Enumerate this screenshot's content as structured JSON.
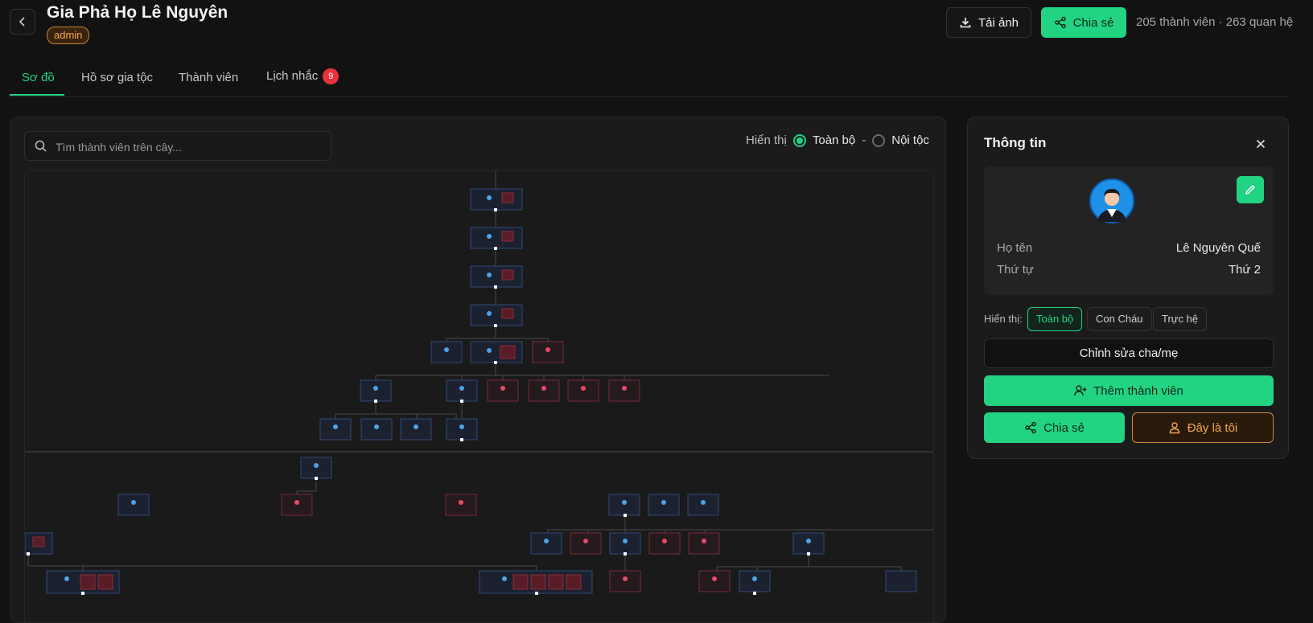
{
  "header": {
    "title": "Gia Phả Họ Lê Nguyên",
    "role_badge": "admin",
    "download_label": "Tải ảnh",
    "share_label": "Chia sẻ",
    "stats": "205 thành viên · 263 quan hệ"
  },
  "tabs": [
    {
      "label": "Sơ đồ",
      "active": true
    },
    {
      "label": "Hồ sơ gia tộc",
      "active": false
    },
    {
      "label": "Thành viên",
      "active": false
    },
    {
      "label": "Lịch nhắc",
      "active": false,
      "badge": "9"
    }
  ],
  "tree": {
    "search_placeholder": "Tìm thành viên trên cây...",
    "view_label": "Hiển thị",
    "view_options": [
      "Toàn bộ",
      "Nội tộc"
    ],
    "view_selected": "Toàn bộ",
    "separator": "-"
  },
  "info_panel": {
    "title": "Thông tin",
    "fields": [
      {
        "label": "Họ tên",
        "value": "Lê Nguyên Quế"
      },
      {
        "label": "Thứ tự",
        "value": "Thứ 2"
      }
    ],
    "show_label": "Hiển thị:",
    "show_options": [
      "Toàn bộ",
      "Con Cháu",
      "Trực hệ"
    ],
    "show_selected": "Toàn bộ",
    "edit_parents_label": "Chỉnh sửa cha/mẹ",
    "add_member_label": "Thêm thành viên",
    "share_label": "Chia sẻ",
    "this_is_me_label": "Đây là tôi"
  },
  "colors": {
    "accent": "#22d382",
    "male_node": "#2a4a7a",
    "female_node": "#7a2a38",
    "warning": "#f0a54a",
    "badge_red": "#e8323c"
  },
  "icons": [
    "chevron-left-icon",
    "download-icon",
    "share-icon",
    "search-icon",
    "close-icon",
    "pencil-icon",
    "user-plus-icon",
    "user-icon"
  ]
}
